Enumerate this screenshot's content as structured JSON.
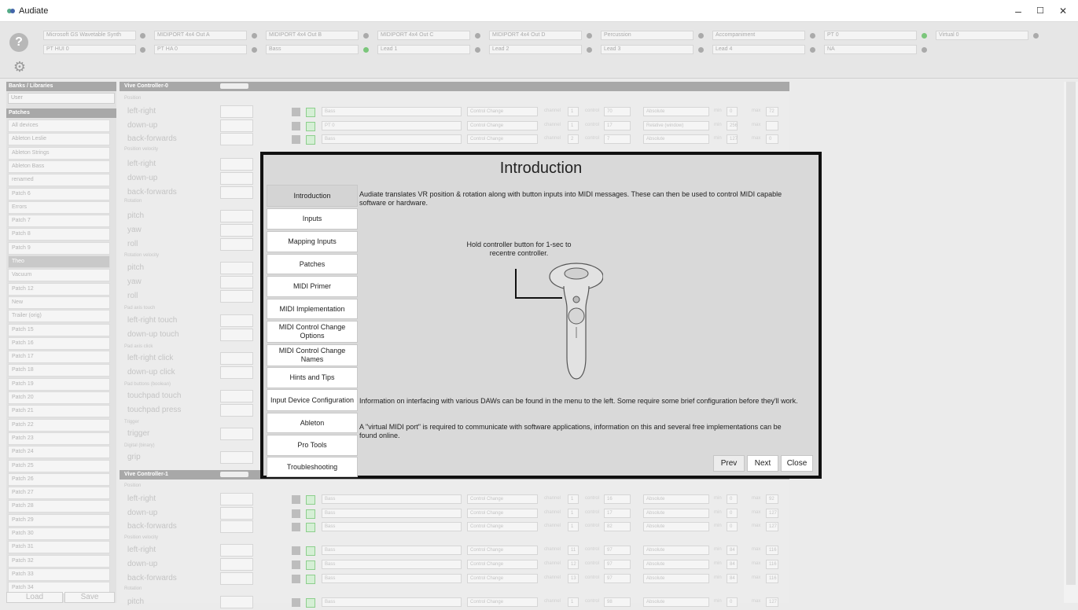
{
  "app": {
    "title": "Audiate"
  },
  "window": {
    "minimize": "–",
    "maximize": "☐",
    "close": "✕"
  },
  "toolbar": {
    "help": "?",
    "gear": "⚙",
    "ports_row1": [
      "Microsoft GS Wavetable Synth",
      "MIDIPORT 4x4 Out A",
      "MIDIPORT 4x4 Out B",
      "MIDIPORT 4x4 Out C",
      "MIDIPORT 4x4 Out D",
      "Percussion",
      "Accompaniment",
      "PT 0",
      "Virtual 0"
    ],
    "ports_row2": [
      "PT HUI 0",
      "PT HA 0",
      "Bass",
      "Lead 1",
      "Lead 2",
      "Lead 3",
      "Lead 4",
      "NA"
    ]
  },
  "sidebar": {
    "banks_header": "Banks / Libraries",
    "bank_value": "User",
    "patches_header": "Patches",
    "patches": [
      "All devices",
      "Ableton Leslie",
      "Ableton Strings",
      "Ableton Bass",
      "renamed",
      "Patch 6",
      "Errors",
      "Patch 7",
      "Patch 8",
      "Patch 9",
      "Theo",
      "Vacuum",
      "Patch 12",
      "New",
      "Trailer (orig)",
      "Patch 15",
      "Patch 16",
      "Patch 17",
      "Patch 18",
      "Patch 19",
      "Patch 20",
      "Patch 21",
      "Patch 22",
      "Patch 23",
      "Patch 24",
      "Patch 25",
      "Patch 26",
      "Patch 27",
      "Patch 28",
      "Patch 29",
      "Patch 30",
      "Patch 31",
      "Patch 32",
      "Patch 33",
      "Patch 34"
    ],
    "selected_index": 10,
    "load": "Load",
    "save": "Save"
  },
  "main": {
    "controller0": "Vive Controller-0",
    "controller1": "Vive Controller-1",
    "groups": {
      "position": "Position",
      "position_velocity": "Position velocity",
      "rotation": "Rotation",
      "rotation_velocity": "Rotation velocity",
      "pad_axis_touch": "Pad axis touch",
      "pad_axis_click": "Pad axis click",
      "pad_buttons": "Pad buttons (boolean)",
      "trigger": "Trigger",
      "digital": "Digital (binary)"
    },
    "rows0": [
      "left-right",
      "down-up",
      "back-forwards",
      "left-right",
      "down-up",
      "back-forwards",
      "pitch",
      "yaw",
      "roll",
      "pitch",
      "yaw",
      "roll",
      "left-right touch",
      "down-up touch",
      "left-right click",
      "down-up click",
      "touchpad touch",
      "touchpad press",
      "trigger",
      "grip"
    ],
    "rows1": [
      "left-right",
      "down-up",
      "back-forwards",
      "left-right",
      "down-up",
      "back-forwards",
      "pitch"
    ],
    "mapping": {
      "channel_label": "channel",
      "control_label": "control",
      "min_label": "min",
      "max_label": "max",
      "tick_label": "tick count",
      "invert_label": "inverted",
      "r0": [
        "Bass",
        "Control Change",
        "1",
        "70",
        "Absolute",
        "0",
        "72"
      ],
      "r1": [
        "PT 0",
        "Control Change",
        "1",
        "17",
        "Relative (window)",
        "256",
        ""
      ],
      "r2": [
        "Bass",
        "Control Change",
        "2",
        "7",
        "Absolute",
        "127",
        "0"
      ],
      "c1_r0": [
        "Bass",
        "Control Change",
        "1",
        "16",
        "Absolute",
        "0",
        "92"
      ],
      "c1_r1": [
        "Bass",
        "Control Change",
        "1",
        "17",
        "Absolute",
        "0",
        "127"
      ],
      "c1_r2": [
        "Bass",
        "Control Change",
        "1",
        "82",
        "Absolute",
        "0",
        "127"
      ],
      "c1_r3": [
        "Bass",
        "Control Change",
        "11",
        "97",
        "Absolute",
        "84",
        "116"
      ],
      "c1_r4": [
        "Bass",
        "Control Change",
        "12",
        "97",
        "Absolute",
        "84",
        "116"
      ],
      "c1_r5": [
        "Bass",
        "Control Change",
        "13",
        "97",
        "Absolute",
        "84",
        "116"
      ],
      "c1_r6": [
        "Bass",
        "Control Change",
        "1",
        "98",
        "Absolute",
        "0",
        "127"
      ]
    }
  },
  "modal": {
    "title": "Introduction",
    "nav": [
      "Introduction",
      "Inputs",
      "Mapping Inputs",
      "Patches",
      "MIDI Primer",
      "MIDI Implementation",
      "MIDI Control Change Options",
      "MIDI Control Change Names",
      "Hints and Tips",
      "Input Device Configuration",
      "Ableton",
      "Pro Tools",
      "Troubleshooting"
    ],
    "active_index": 0,
    "para1": "Audiate translates VR position & rotation along with button inputs into MIDI messages. These can then be used to control MIDI capable software or hardware.",
    "caption": "Hold controller button for 1-sec to recentre controller.",
    "para2": "Information on interfacing with various DAWs can be found in the menu to the left. Some require some brief configuration before they'll work.",
    "para3": "A \"virtual MIDI port\" is required to communicate with software applications, information on this and several free implementations can be found online.",
    "prev": "Prev",
    "next": "Next",
    "close": "Close"
  }
}
